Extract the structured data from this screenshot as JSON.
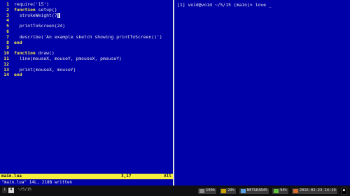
{
  "editor": {
    "lines": [
      {
        "num": "1",
        "parts": [
          {
            "t": "require('15')"
          }
        ]
      },
      {
        "num": "2",
        "parts": [
          {
            "t": "function ",
            "kw": true
          },
          {
            "t": "setup()"
          }
        ]
      },
      {
        "num": "3",
        "parts": [
          {
            "t": "  strokeWeight(7"
          }
        ],
        "cursor": ")"
      },
      {
        "num": "4",
        "parts": [
          {
            "t": ""
          }
        ]
      },
      {
        "num": "5",
        "parts": [
          {
            "t": "  printToScreen(24)"
          }
        ]
      },
      {
        "num": "6",
        "parts": [
          {
            "t": ""
          }
        ]
      },
      {
        "num": "7",
        "parts": [
          {
            "t": "  describe('An example sketch showing printToScreen()')"
          }
        ]
      },
      {
        "num": "8",
        "parts": [
          {
            "t": "end",
            "kw": true
          }
        ]
      },
      {
        "num": "9",
        "parts": [
          {
            "t": ""
          }
        ]
      },
      {
        "num": "10",
        "parts": [
          {
            "t": "function ",
            "kw": true
          },
          {
            "t": "draw()"
          }
        ]
      },
      {
        "num": "11",
        "parts": [
          {
            "t": "  line(mouseX, mouseY, pmouseX, pmouseY)"
          }
        ]
      },
      {
        "num": "12",
        "parts": [
          {
            "t": ""
          }
        ]
      },
      {
        "num": "13",
        "parts": [
          {
            "t": "  print(mouseX, mouseY)"
          }
        ]
      },
      {
        "num": "14",
        "parts": [
          {
            "t": "end",
            "kw": true
          }
        ]
      }
    ],
    "status": {
      "file": "main.lua",
      "position": "3,17",
      "scroll": "All"
    },
    "message": "\"main.lua\" 14L, 218B written"
  },
  "terminal": {
    "prompt": "[1] void@void ~/5/15 (main)> love _"
  },
  "tmux": {
    "window_index": "1",
    "window_number": "4",
    "path": "~/5/15",
    "right": [
      {
        "icon": "cpu",
        "text": "100%"
      },
      {
        "icon": "mem",
        "text": "29%"
      },
      {
        "icon": "net",
        "text": "NETGEAR45"
      },
      {
        "icon": "bat",
        "text": "94%"
      },
      {
        "icon": "clk",
        "text": "2016-02-23 14:19"
      },
      {
        "icon": "blk",
        "text": "●"
      }
    ]
  }
}
